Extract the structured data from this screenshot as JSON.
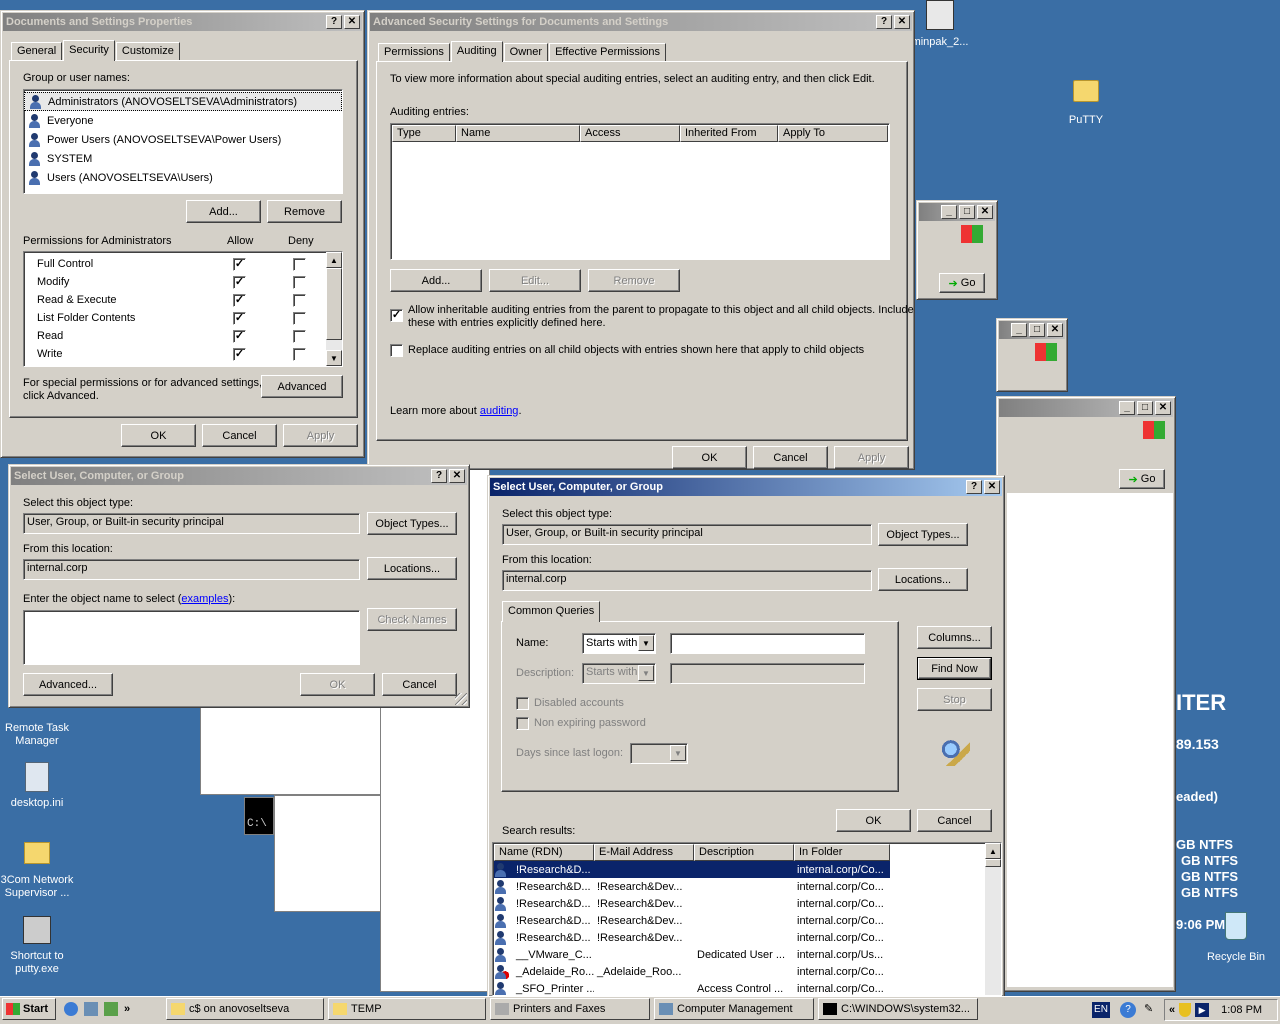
{
  "desktop": {
    "icons": [
      {
        "label": "minpak_2..."
      },
      {
        "label": "PuTTY"
      },
      {
        "label": "Remote Task Manager"
      },
      {
        "label": "desktop.ini"
      },
      {
        "label": "3Com Network Supervisor ..."
      },
      {
        "label": "Shortcut to putty.exe"
      },
      {
        "label": "Recycle Bin"
      }
    ],
    "bginfo": [
      "ITER",
      "89.153",
      "eaded)",
      "GB NTFS",
      "GB NTFS",
      "GB NTFS",
      "GB NTFS",
      "9:06 PM"
    ]
  },
  "bg_windows": {
    "go_label": "Go",
    "console_text": "C:\\"
  },
  "props": {
    "title": "Documents and Settings Properties",
    "tabs": [
      "General",
      "Security",
      "Customize"
    ],
    "group_label": "Group or user names:",
    "users": [
      "Administrators (ANOVOSELTSEVA\\Administrators)",
      "Everyone",
      "Power Users (ANOVOSELTSEVA\\Power Users)",
      "SYSTEM",
      "Users (ANOVOSELTSEVA\\Users)"
    ],
    "add": "Add...",
    "remove": "Remove",
    "perm_label": "Permissions for Administrators",
    "allow": "Allow",
    "deny": "Deny",
    "perms": [
      {
        "name": "Full Control",
        "allow": "✓",
        "deny": ""
      },
      {
        "name": "Modify",
        "allow": "✓",
        "deny": ""
      },
      {
        "name": "Read & Execute",
        "allow": "✓",
        "deny": ""
      },
      {
        "name": "List Folder Contents",
        "allow": "✓",
        "deny": ""
      },
      {
        "name": "Read",
        "allow": "✓",
        "deny": ""
      },
      {
        "name": "Write",
        "allow": "✓",
        "deny": ""
      }
    ],
    "special1": "For special permissions or for advanced settings,",
    "special2": "click Advanced.",
    "advanced": "Advanced",
    "ok": "OK",
    "cancel": "Cancel",
    "apply": "Apply"
  },
  "adv": {
    "title": "Advanced Security Settings for Documents and Settings",
    "tabs": [
      "Permissions",
      "Auditing",
      "Owner",
      "Effective Permissions"
    ],
    "info": "To view more information about special auditing entries, select an auditing entry, and then click Edit.",
    "entries_label": "Auditing entries:",
    "cols": [
      "Type",
      "Name",
      "Access",
      "Inherited From",
      "Apply To"
    ],
    "add": "Add...",
    "edit": "Edit...",
    "remove": "Remove",
    "inherit_check": "✓",
    "inherit1": "Allow inheritable auditing entries from the parent to propagate to this object and all child objects. Include",
    "inherit2": "these with entries explicitly defined here.",
    "replace_check": "",
    "replace": "Replace auditing entries on all child objects with entries shown here that apply to child objects",
    "learn": "Learn more about ",
    "learn_link": "auditing",
    "learn_end": ".",
    "ok": "OK",
    "cancel": "Cancel",
    "apply": "Apply"
  },
  "sel1": {
    "title": "Select User, Computer, or Group",
    "type_label": "Select this object type:",
    "type_value": "User, Group, or Built-in security principal",
    "object_types": "Object Types...",
    "loc_label": "From this location:",
    "loc_value": "internal.corp",
    "locations": "Locations...",
    "enter_label": "Enter the object name to select (",
    "examples": "examples",
    "enter_end": "):",
    "check_names": "Check Names",
    "advanced": "Advanced...",
    "ok": "OK",
    "cancel": "Cancel"
  },
  "sel2": {
    "title": "Select User, Computer, or Group",
    "type_label": "Select this object type:",
    "type_value": "User, Group, or Built-in security principal",
    "object_types": "Object Types...",
    "loc_label": "From this location:",
    "loc_value": "internal.corp",
    "locations": "Locations...",
    "tab": "Common Queries",
    "name_label": "Name:",
    "starts_with": "Starts with",
    "desc_label": "Description:",
    "starts_with2": "Starts with",
    "disabled": "Disabled accounts",
    "nonexp": "Non expiring password",
    "days": "Days since last logon:",
    "columns": "Columns...",
    "find_now": "Find Now",
    "stop": "Stop",
    "ok": "OK",
    "cancel": "Cancel",
    "results_label": "Search results:",
    "rcols": [
      "Name (RDN)",
      "E-Mail Address",
      "Description",
      "In Folder"
    ],
    "rows": [
      {
        "name": "!Research&D...",
        "email": "",
        "desc": "",
        "folder": "internal.corp/Co..."
      },
      {
        "name": "!Research&D...",
        "email": "!Research&Dev...",
        "desc": "",
        "folder": "internal.corp/Co..."
      },
      {
        "name": "!Research&D...",
        "email": "!Research&Dev...",
        "desc": "",
        "folder": "internal.corp/Co..."
      },
      {
        "name": "!Research&D...",
        "email": "!Research&Dev...",
        "desc": "",
        "folder": "internal.corp/Co..."
      },
      {
        "name": "!Research&D...",
        "email": "!Research&Dev...",
        "desc": "",
        "folder": "internal.corp/Co..."
      },
      {
        "name": "__VMware_C...",
        "email": "",
        "desc": "Dedicated User ...",
        "folder": "internal.corp/Us..."
      },
      {
        "name": "_Adelaide_Ro...",
        "email": "_Adelaide_Roo...",
        "desc": "",
        "folder": "internal.corp/Co..."
      },
      {
        "name": "_SFO_Printer ...",
        "email": "",
        "desc": "Access Control ...",
        "folder": "internal.corp/Co..."
      }
    ]
  },
  "taskbar": {
    "start": "Start",
    "tasks": [
      "c$ on anovoseltseva",
      "TEMP",
      "Printers and Faxes",
      "Computer Management",
      "C:\\WINDOWS\\system32..."
    ],
    "lang": "EN",
    "time": "1:08 PM"
  }
}
